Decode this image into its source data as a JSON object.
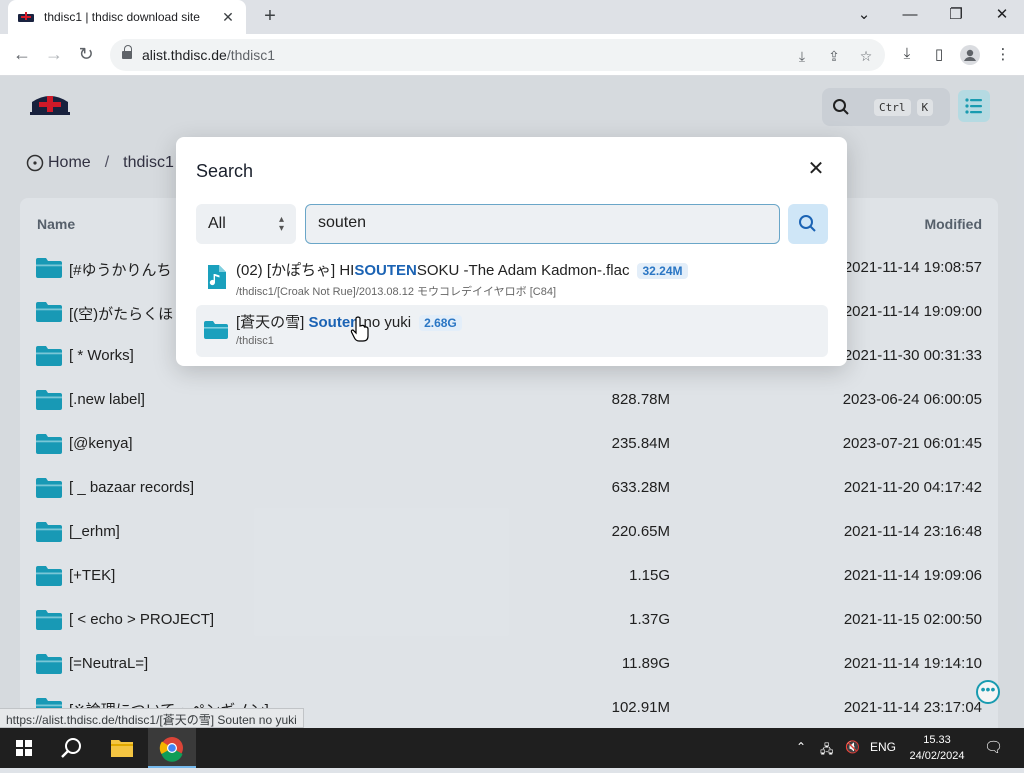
{
  "browser": {
    "tab_title": "thdisc1 | thdisc download site",
    "url_host": "alist.thdisc.de",
    "url_path": "/thdisc1",
    "status_url": "https://alist.thdisc.de/thdisc1/[蒼天の雪] Souten no yuki"
  },
  "header": {
    "shortcut_ctrl": "Ctrl",
    "shortcut_k": "K"
  },
  "breadcrumb": [
    "Home",
    "/",
    "thdisc1"
  ],
  "list": {
    "col_name": "Name",
    "col_modified": "Modified",
    "rows": [
      {
        "name": "[#ゆうかりんち",
        "size": "",
        "date": "2021-11-14 19:08:57"
      },
      {
        "name": "[(空)がたらくほ",
        "size": "",
        "date": "2021-11-14 19:09:00"
      },
      {
        "name": "[ * Works]",
        "size": "",
        "date": "2021-11-30 00:31:33"
      },
      {
        "name": "[.new label]",
        "size": "828.78M",
        "date": "2023-06-24 06:00:05"
      },
      {
        "name": "[@kenya]",
        "size": "235.84M",
        "date": "2023-07-21 06:01:45"
      },
      {
        "name": "[ _ bazaar records]",
        "size": "633.28M",
        "date": "2021-11-20 04:17:42"
      },
      {
        "name": "[_erhm]",
        "size": "220.65M",
        "date": "2021-11-14 23:16:48"
      },
      {
        "name": "[+TEK]",
        "size": "1.15G",
        "date": "2021-11-14 19:09:06"
      },
      {
        "name": "[ < echo > PROJECT]",
        "size": "1.37G",
        "date": "2021-11-15 02:00:50"
      },
      {
        "name": "[=NeutraL=]",
        "size": "11.89G",
        "date": "2021-11-14 19:14:10"
      },
      {
        "name": "[※論理について・ペンギノン]",
        "size": "102.91M",
        "date": "2021-11-14 23:17:04"
      }
    ]
  },
  "search": {
    "title": "Search",
    "scope": "All",
    "query": "souten",
    "results": [
      {
        "name_pre": "(02) [かぽちゃ] HI",
        "name_hl": "SOUTEN",
        "name_post": "SOKU -The Adam Kadmon-.flac",
        "size": "32.24M",
        "path": "/thdisc1/[Croak Not Rue]/2013.08.12 モウコレデイイヤロボ [C84]",
        "icon": "music-file-icon"
      },
      {
        "name_pre": "[蒼天の雪] ",
        "name_hl": "Souten",
        "name_post": " no yuki",
        "size": "2.68G",
        "path": "/thdisc1",
        "icon": "folder-icon"
      }
    ]
  },
  "taskbar": {
    "language": "ENG",
    "time": "15.33",
    "date": "24/02/2024"
  },
  "colors": {
    "accent": "#1ba2b8",
    "folder": "#1aa0bd",
    "highlight": "#1b63b4"
  }
}
